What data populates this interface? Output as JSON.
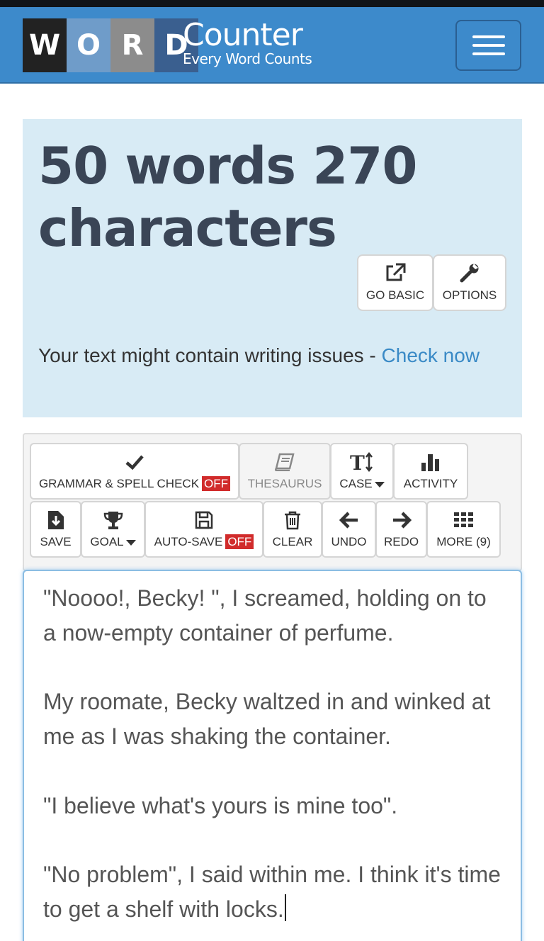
{
  "logo": {
    "letters": [
      "W",
      "O",
      "R",
      "D"
    ],
    "title": "Counter",
    "tagline": "Every Word Counts"
  },
  "colors": {
    "navbar": "#3d8acb",
    "panel": "#d8ebf5",
    "link": "#3a8ac6",
    "off_badge": "#d12b2b",
    "heading": "#3a4556"
  },
  "stats": {
    "text": "50 words 270 characters"
  },
  "panel_buttons": {
    "go_basic": {
      "label": "GO BASIC",
      "icon": "external-link-icon"
    },
    "options": {
      "label": "OPTIONS",
      "icon": "wrench-icon"
    }
  },
  "writing_issues": {
    "text": "Your text might contain writing issues - ",
    "link": "Check now"
  },
  "toolbar": {
    "grammar": {
      "label": "GRAMMAR & SPELL CHECK",
      "badge": "OFF",
      "icon": "checkmark-icon"
    },
    "thesaurus": {
      "label": "THESAURUS",
      "icon": "book-icon"
    },
    "case": {
      "label": "CASE",
      "icon": "text-case-icon"
    },
    "activity": {
      "label": "ACTIVITY",
      "icon": "bar-chart-icon"
    },
    "save": {
      "label": "SAVE",
      "icon": "save-file-icon"
    },
    "goal": {
      "label": "GOAL",
      "icon": "trophy-icon"
    },
    "autosave": {
      "label": "AUTO-SAVE",
      "badge": "OFF",
      "icon": "floppy-disk-icon"
    },
    "clear": {
      "label": "CLEAR",
      "icon": "trash-icon"
    },
    "undo": {
      "label": "UNDO",
      "icon": "arrow-left-icon"
    },
    "redo": {
      "label": "REDO",
      "icon": "arrow-right-icon"
    },
    "more": {
      "label": "MORE (9)",
      "icon": "grid-icon"
    }
  },
  "editor": {
    "paragraphs": [
      "\"Noooo!, Becky! \", I screamed, holding on to a now-empty container of perfume.",
      "",
      "My roomate, Becky waltzed in and winked at me as I was shaking the container.",
      "",
      "\"I believe what's yours is mine too\".",
      "",
      "\"No problem\", I said within me. I think it's time to get a shelf with locks."
    ]
  }
}
